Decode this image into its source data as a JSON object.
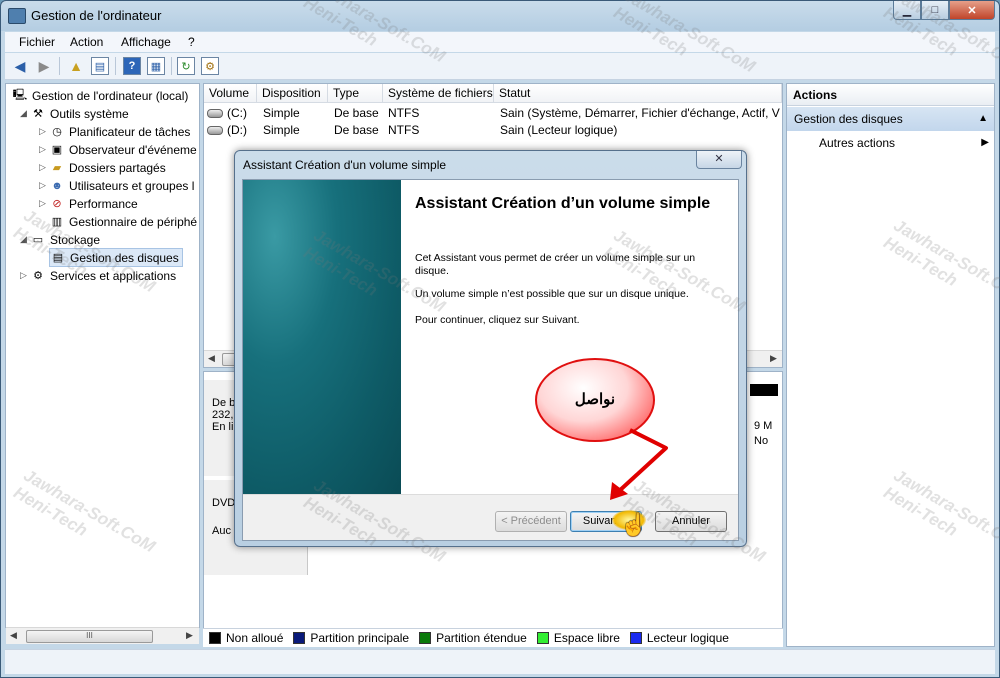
{
  "window": {
    "title": "Gestion de l'ordinateur",
    "min": "▁",
    "max": "□",
    "close": "✕"
  },
  "menu": [
    "Fichier",
    "Action",
    "Affichage",
    "?"
  ],
  "toolbar": {
    "back": "back-arrow-icon",
    "forward": "forward-arrow-icon",
    "help_glyph": "?"
  },
  "tree": {
    "root": "Gestion de l'ordinateur (local)",
    "outils": "Outils système",
    "planif": "Planificateur de tâches",
    "observ": "Observateur d'événeme",
    "dossiers": "Dossiers partagés",
    "users": "Utilisateurs et groupes l",
    "perf": "Performance",
    "periph": "Gestionnaire de périphé",
    "stockage": "Stockage",
    "disques": "Gestion des disques",
    "services": "Services et applications",
    "scroll_thumb": "III"
  },
  "volumes": {
    "headers": {
      "volume": "Volume",
      "disposition": "Disposition",
      "type": "Type",
      "fs": "Système de fichiers",
      "statut": "Statut"
    },
    "rows": [
      {
        "volume": "(C:)",
        "disposition": "Simple",
        "type": "De base",
        "fs": "NTFS",
        "statut": "Sain (Système, Démarrer, Fichier d'échange, Actif, Vid"
      },
      {
        "volume": "(D:)",
        "disposition": "Simple",
        "type": "De base",
        "fs": "NTFS",
        "statut": "Sain (Lecteur logique)"
      }
    ]
  },
  "disks": {
    "d0_l1": "De b",
    "d0_l2": "232,",
    "d0_l3": "En li",
    "d1_l1": "DVD",
    "d1_l2": "Auc",
    "right_l1": "9 M",
    "right_l2": "No"
  },
  "legend": [
    {
      "label": "Non alloué",
      "color": "#000000"
    },
    {
      "label": "Partition principale",
      "color": "#0a1a7a"
    },
    {
      "label": "Partition étendue",
      "color": "#0a7a0a"
    },
    {
      "label": "Espace libre",
      "color": "#33ee33"
    },
    {
      "label": "Lecteur logique",
      "color": "#1a2aee"
    }
  ],
  "actions": {
    "header": "Actions",
    "section": "Gestion des disques",
    "item": "Autres actions"
  },
  "dialog": {
    "title": "Assistant Création d'un volume simple",
    "heading": "Assistant Création d’un volume simple",
    "p1": "Cet Assistant vous permet de créer un volume simple sur un disque.",
    "p2": "Un volume simple n’est possible que sur un disque unique.",
    "p3": "Pour continuer, cliquez sur Suivant.",
    "back_label": "< Précédent",
    "next_label": "Suivant >",
    "cancel_label": "Annuler"
  },
  "annotation": {
    "text": "نواصل"
  },
  "watermark": {
    "line1": "Jawhara-Soft.CoM",
    "line2": "Heni-Tech"
  }
}
